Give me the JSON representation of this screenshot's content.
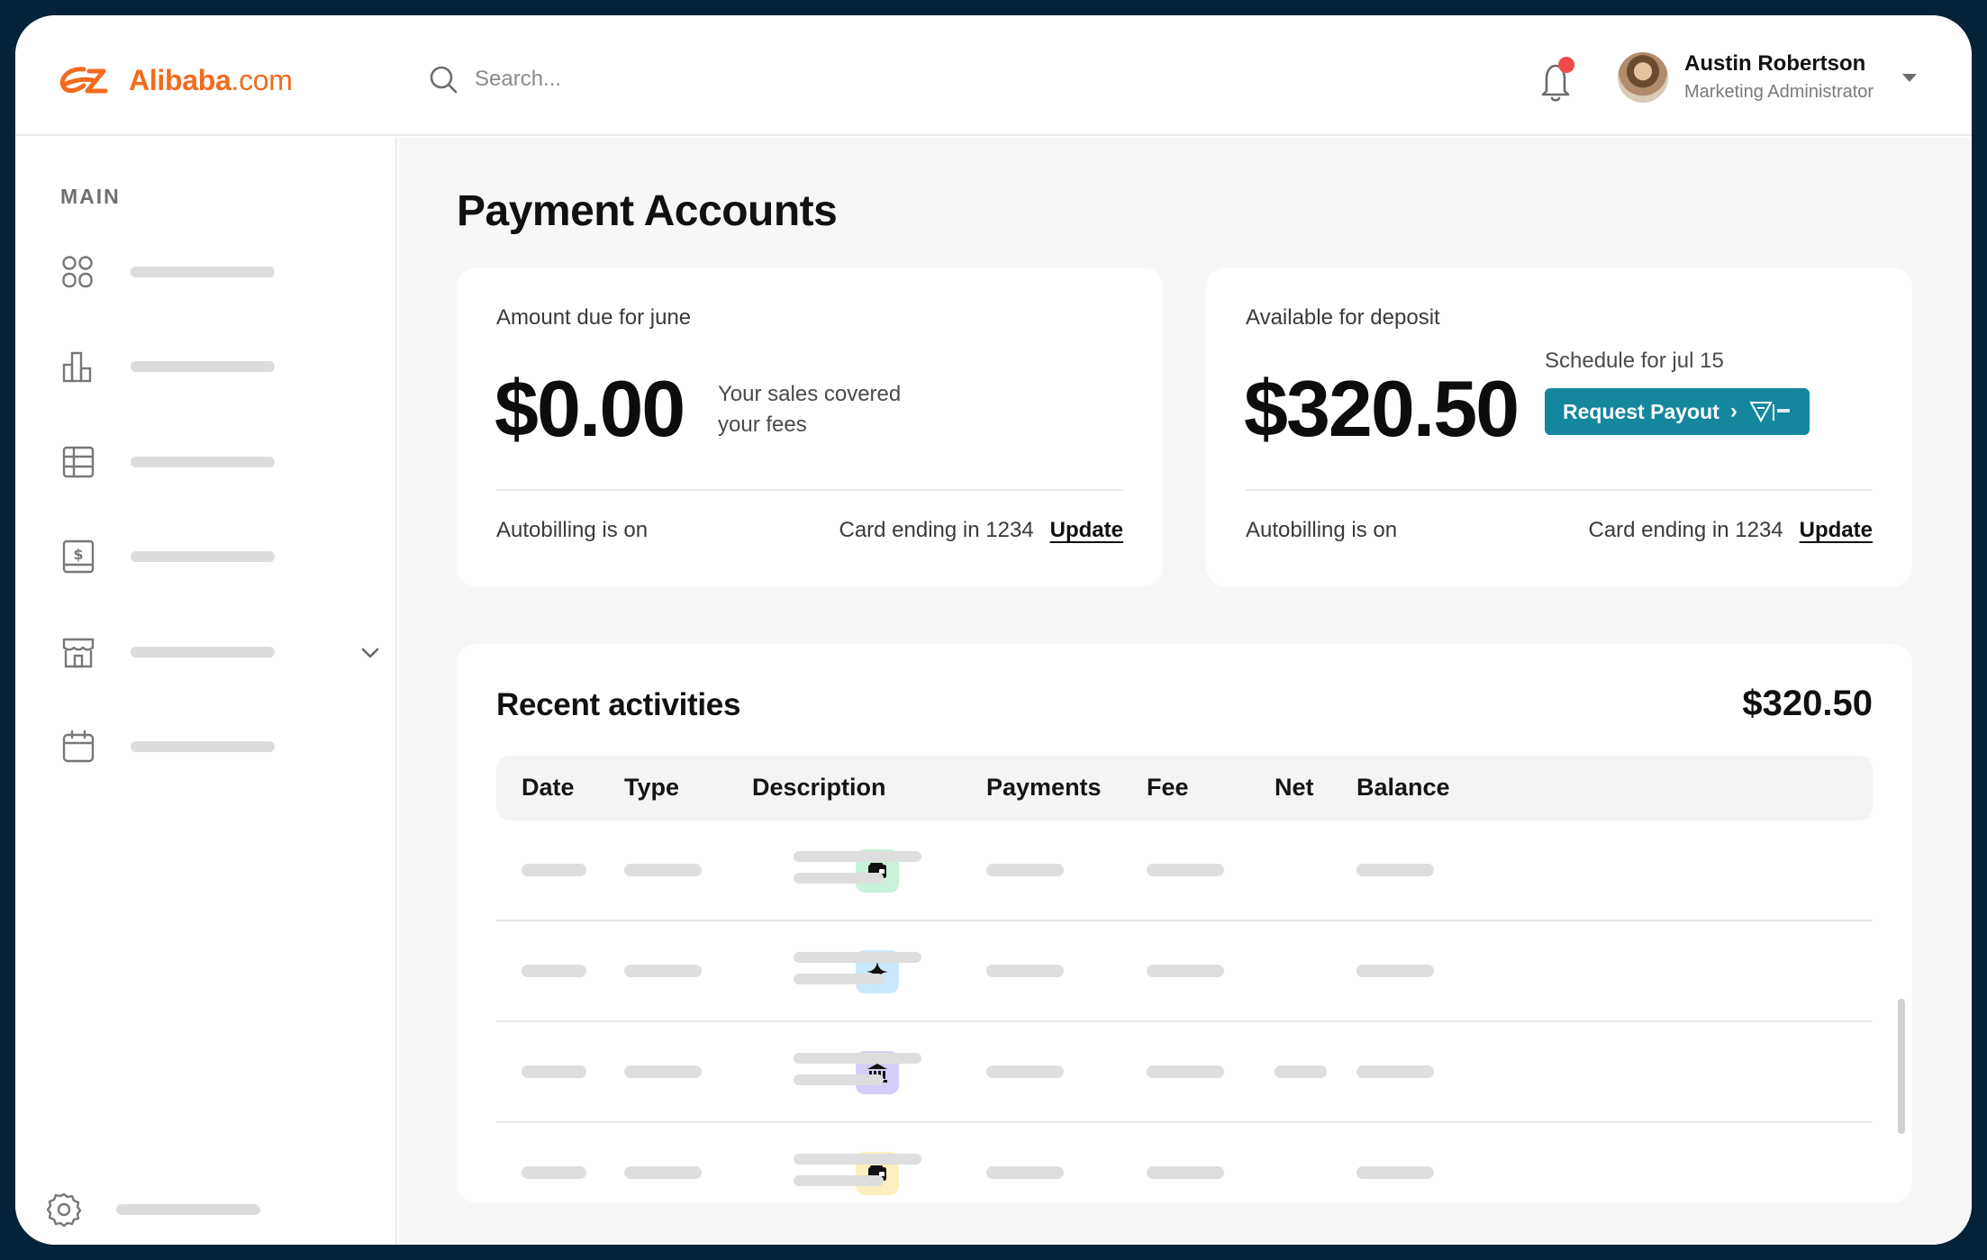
{
  "brand": {
    "name": "Alibaba",
    "tld": ".com",
    "accent": "#f26b1d"
  },
  "search": {
    "placeholder": "Search..."
  },
  "notifications": {
    "icon": "bell-icon",
    "has_unread": true
  },
  "user": {
    "name": "Austin Robertson",
    "role": "Marketing Administrator"
  },
  "sidebar": {
    "section_label": "MAIN",
    "items": [
      {
        "icon": "dashboard-grid-icon"
      },
      {
        "icon": "bar-chart-icon"
      },
      {
        "icon": "table-icon"
      },
      {
        "icon": "invoice-dollar-icon"
      },
      {
        "icon": "store-icon",
        "expandable": true
      },
      {
        "icon": "calendar-icon"
      }
    ],
    "footer_icon": "settings-gear-icon"
  },
  "page": {
    "title": "Payment Accounts"
  },
  "amount_due": {
    "label": "Amount due for june",
    "amount": "$0.00",
    "note": "Your sales covered your fees",
    "autobilling": "Autobilling is on",
    "card_info": "Card ending in 1234",
    "update_label": "Update"
  },
  "deposit": {
    "label": "Available for deposit",
    "amount": "$320.50",
    "schedule": "Schedule for jul 15",
    "payout_label": "Request Payout",
    "payout_color": "#14869e",
    "autobilling": "Autobilling is on",
    "card_info": "Card ending in 1234",
    "update_label": "Update"
  },
  "activities": {
    "title": "Recent activities",
    "total": "$320.50",
    "columns": [
      "Date",
      "Type",
      "Description",
      "Payments",
      "Fee",
      "Net",
      "Balance"
    ],
    "rows": [
      {
        "icon": "wallet-icon",
        "icon_bg": "#c8f2d9",
        "net_shown": false
      },
      {
        "icon": "sparkle-icon",
        "icon_bg": "#c9e9fb",
        "net_shown": false
      },
      {
        "icon": "bank-icon",
        "icon_bg": "#d5cdfa",
        "net_shown": true
      },
      {
        "icon": "wallet-icon",
        "icon_bg": "#fbefbf",
        "net_shown": false
      }
    ]
  }
}
